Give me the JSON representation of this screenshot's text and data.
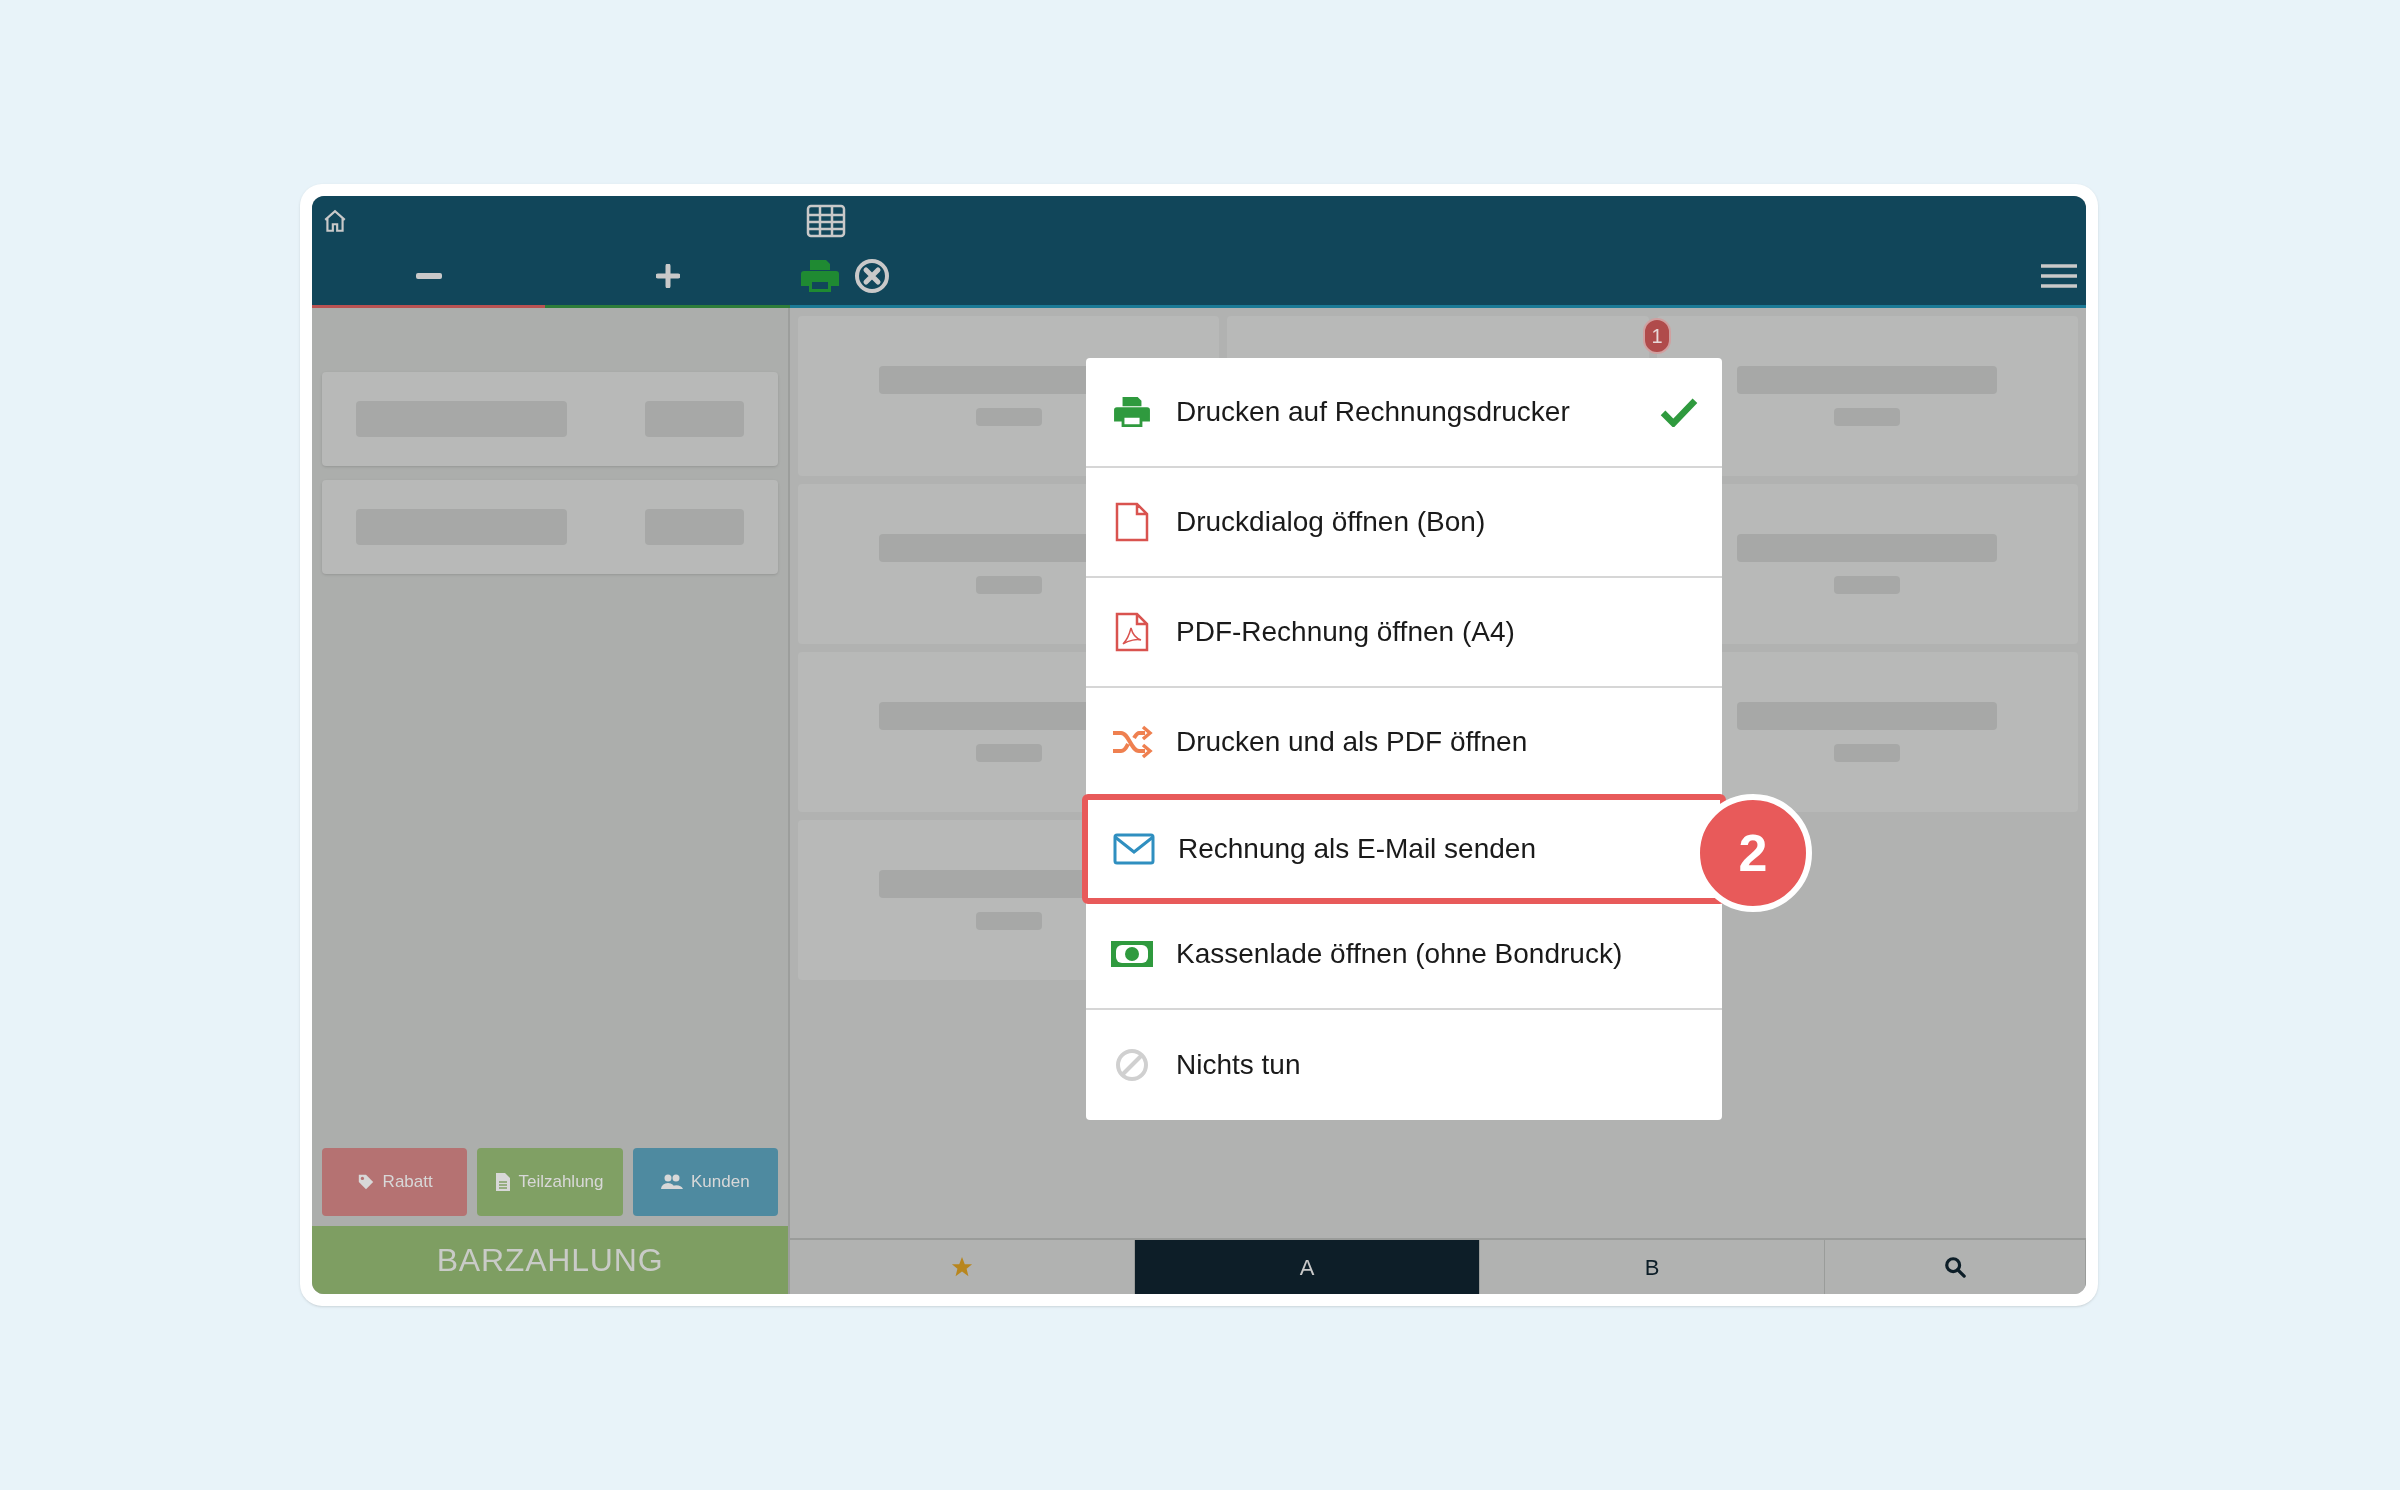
{
  "toolbar": {
    "badge": "1"
  },
  "action_buttons": [
    {
      "label": "Rabatt",
      "kind": "tag"
    },
    {
      "label": "Teilzahlung",
      "kind": "document"
    },
    {
      "label": "Kunden",
      "kind": "people"
    }
  ],
  "pay_button": {
    "label": "BARZAHLUNG"
  },
  "bottom_tabs": [
    {
      "kind": "star",
      "selected": false
    },
    {
      "kind": "text",
      "label": "A",
      "selected": true
    },
    {
      "kind": "text",
      "label": "B",
      "selected": false
    },
    {
      "kind": "search",
      "selected": false
    }
  ],
  "print_menu": [
    {
      "kind": "printer",
      "label": "Drucken auf Rechnungsdrucker",
      "checked": true,
      "highlighted": false
    },
    {
      "kind": "file",
      "label": "Druckdialog öffnen (Bon)",
      "checked": false,
      "highlighted": false
    },
    {
      "kind": "pdf",
      "label": "PDF-Rechnung öffnen (A4)",
      "checked": false,
      "highlighted": false
    },
    {
      "kind": "shuffle",
      "label": "Drucken und als PDF öffnen",
      "checked": false,
      "highlighted": false
    },
    {
      "kind": "mail",
      "label": "Rechnung als E-Mail senden",
      "checked": false,
      "highlighted": true
    },
    {
      "kind": "cash",
      "label": "Kassenlade öffnen (ohne Bondruck)",
      "checked": false,
      "highlighted": false
    },
    {
      "kind": "none",
      "label": "Nichts tun",
      "checked": false,
      "highlighted": false
    }
  ],
  "step_marker": "2"
}
